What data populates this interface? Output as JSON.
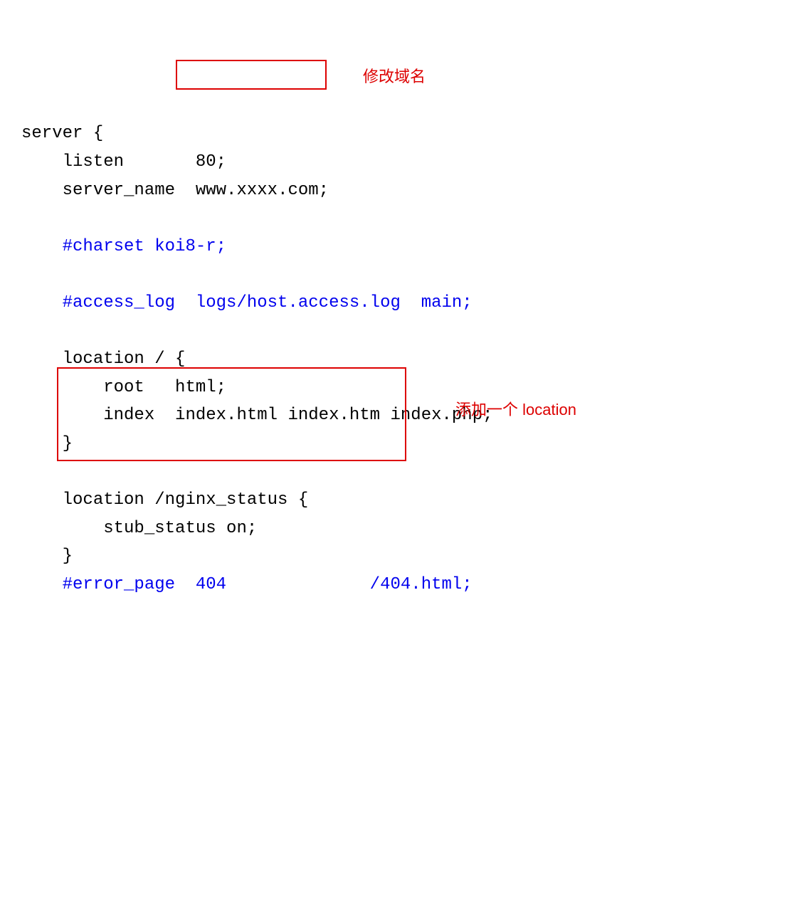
{
  "code": {
    "l1a": "server {",
    "l2a": "    listen       80;",
    "l3a": "    server_name  ",
    "l3b": "www.xxxx.com;",
    "l5a": "    ",
    "l5b": "#charset koi8-r;",
    "l7a": "    ",
    "l7b": "#access_log  logs/host.access.log  main;",
    "l9a": "    location / {",
    "l10a": "        root   html;",
    "l11a": "        index  index.html index.htm index.php;",
    "l12a": "    }",
    "l14a": "    location /nginx_status {",
    "l15a": "        stub_status on;",
    "l16a": "    }",
    "l17a": "    ",
    "l17b": "#error_page  404              /404.html;"
  },
  "annotations": {
    "domain": "修改域名",
    "location": "添加一个 location"
  }
}
